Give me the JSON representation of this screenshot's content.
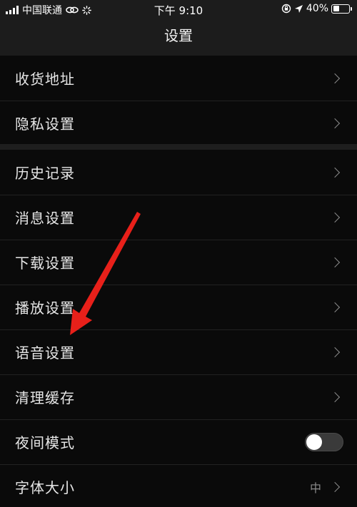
{
  "status_bar": {
    "carrier": "中国联通",
    "time": "下午 9:10",
    "battery": "40%",
    "battery_level": 0.4
  },
  "nav": {
    "title": "设置"
  },
  "groups": [
    [
      {
        "label": "收货地址",
        "accessory": "chevron"
      },
      {
        "label": "隐私设置",
        "accessory": "chevron"
      }
    ],
    [
      {
        "label": "历史记录",
        "accessory": "chevron"
      },
      {
        "label": "消息设置",
        "accessory": "chevron"
      },
      {
        "label": "下载设置",
        "accessory": "chevron"
      },
      {
        "label": "播放设置",
        "accessory": "chevron"
      },
      {
        "label": "语音设置",
        "accessory": "chevron"
      },
      {
        "label": "清理缓存",
        "accessory": "chevron"
      },
      {
        "label": "夜间模式",
        "accessory": "toggle",
        "enabled": false
      },
      {
        "label": "字体大小",
        "accessory": "chevron",
        "value": "中"
      }
    ]
  ],
  "colors": {
    "background": "#0a0a0a",
    "bar": "#1c1c1c",
    "annotation_arrow": "#e8201a"
  }
}
